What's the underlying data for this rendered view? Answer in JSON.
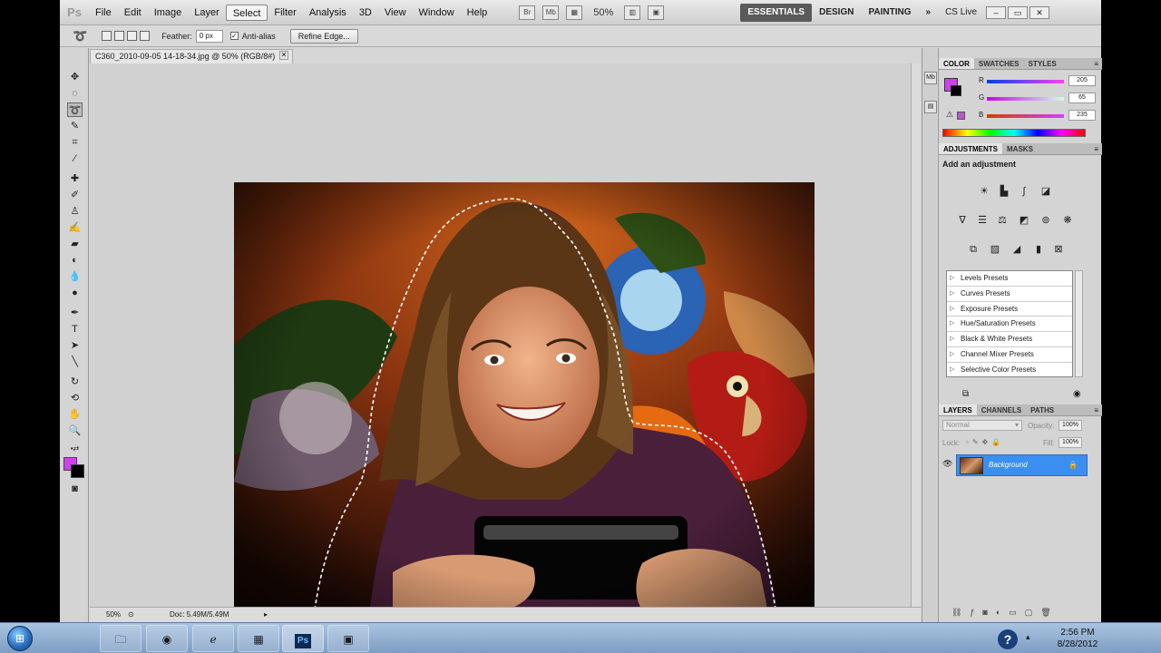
{
  "app": {
    "logo": "Ps"
  },
  "menu": {
    "items": [
      "File",
      "Edit",
      "Image",
      "Layer",
      "Select",
      "Filter",
      "Analysis",
      "3D",
      "View",
      "Window",
      "Help"
    ],
    "active_index": 4,
    "zoom": "50%",
    "workspaces": [
      "ESSENTIALS",
      "DESIGN",
      "PAINTING"
    ],
    "overflow": "»",
    "cs_live": "CS Live"
  },
  "options": {
    "feather_label": "Feather:",
    "feather_value": "0 px",
    "antialias_label": "Anti-alias",
    "antialias_checked": true,
    "refine_label": "Refine Edge..."
  },
  "document": {
    "tab_title": "C360_2010-09-05 14-18-34.jpg @ 50% (RGB/8#)",
    "status_zoom": "50%",
    "status_doc": "Doc: 5.49M/5.49M"
  },
  "color_panel": {
    "tabs": [
      "COLOR",
      "SWATCHES",
      "STYLES"
    ],
    "foreground": "#cd41eb",
    "channels": [
      {
        "label": "R",
        "value": "205"
      },
      {
        "label": "G",
        "value": "65"
      },
      {
        "label": "B",
        "value": "235"
      }
    ]
  },
  "adjustments_panel": {
    "tabs": [
      "ADJUSTMENTS",
      "MASKS"
    ],
    "heading": "Add an adjustment",
    "presets": [
      "Levels Presets",
      "Curves Presets",
      "Exposure Presets",
      "Hue/Saturation Presets",
      "Black & White Presets",
      "Channel Mixer Presets",
      "Selective Color Presets"
    ]
  },
  "layers_panel": {
    "tabs": [
      "LAYERS",
      "CHANNELS",
      "PATHS"
    ],
    "blend_mode": "Normal",
    "opacity_label": "Opacity:",
    "opacity": "100%",
    "lock_label": "Lock:",
    "fill_label": "Fill:",
    "fill": "100%",
    "layer_name": "Background"
  },
  "taskbar": {
    "time": "2:56 PM",
    "date": "8/28/2012",
    "help_glyph": "?"
  },
  "colors": {
    "accent_blue": "#3b8ff0",
    "foreground_swatch": "#cd41eb",
    "background_swatch": "#000000"
  }
}
